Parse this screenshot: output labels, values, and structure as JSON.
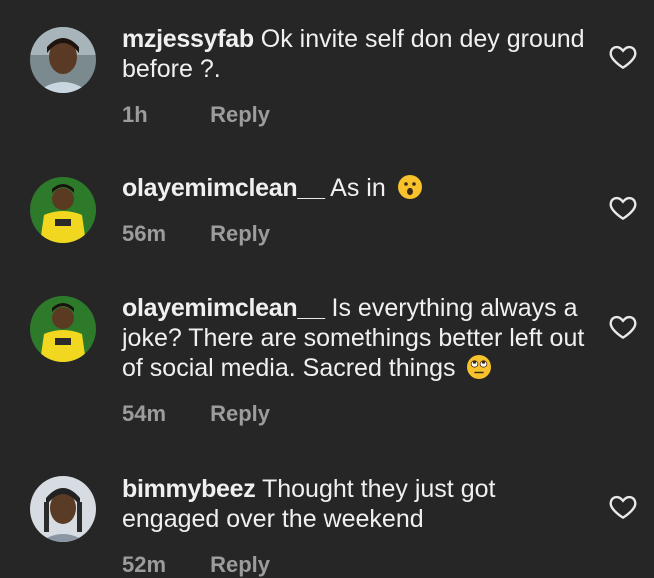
{
  "comments": [
    {
      "username": "mzjessyfab",
      "text": "Ok invite self don dey ground before ?.",
      "time": "1h",
      "reply_label": "Reply",
      "avatar_icon": "woman-selfie-avatar",
      "emoji": ""
    },
    {
      "username": "olayemimclean__",
      "text": "As in",
      "time": "56m",
      "reply_label": "Reply",
      "avatar_icon": "yellow-shirt-avatar",
      "emoji": "surprised-face-emoji"
    },
    {
      "username": "olayemimclean__",
      "text": "Is everything always a joke? There are somethings better left out of social media. Sacred things",
      "time": "54m",
      "reply_label": "Reply",
      "avatar_icon": "yellow-shirt-avatar",
      "emoji": "eye-roll-emoji"
    },
    {
      "username": "bimmybeez",
      "text": "Thought they just got engaged over the weekend",
      "time": "52m",
      "reply_label": "Reply",
      "avatar_icon": "braids-avatar",
      "emoji": ""
    }
  ],
  "colors": {
    "background": "#262626",
    "text": "#f0f0f0",
    "meta": "#9c9c9c",
    "emoji_yellow": "#f7c22b"
  }
}
